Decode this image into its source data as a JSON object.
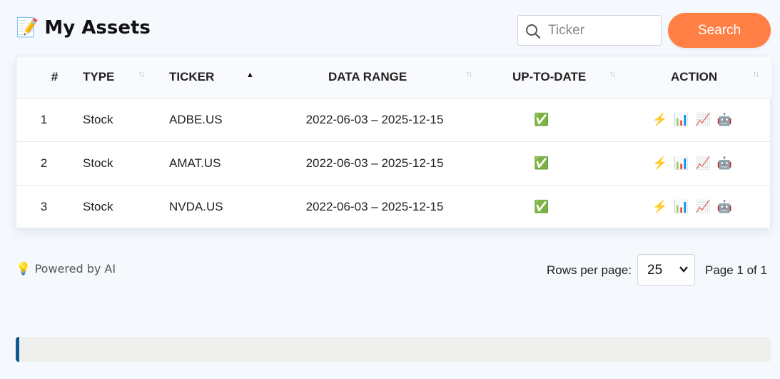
{
  "header": {
    "title_icon": "📝",
    "title": "My Assets",
    "search_placeholder": "Ticker",
    "search_button": "Search"
  },
  "table": {
    "columns": [
      "#",
      "TYPE",
      "TICKER",
      "DATA RANGE",
      "UP-TO-DATE",
      "ACTION"
    ],
    "sorted_column": "TICKER",
    "sort_direction": "ascending",
    "rows": [
      {
        "num": "1",
        "type": "Stock",
        "ticker": "ADBE.US",
        "range": "2022-06-03 – 2025-12-15",
        "up_to_date": "✅"
      },
      {
        "num": "2",
        "type": "Stock",
        "ticker": "AMAT.US",
        "range": "2022-06-03 – 2025-12-15",
        "up_to_date": "✅"
      },
      {
        "num": "3",
        "type": "Stock",
        "ticker": "NVDA.US",
        "range": "2022-06-03 – 2025-12-15",
        "up_to_date": "✅"
      }
    ],
    "action_icons": [
      "lightning-icon",
      "bar-chart-icon",
      "line-chart-icon",
      "robot-icon"
    ]
  },
  "footer": {
    "powered_icon": "💡",
    "powered_text": "Powered by AI",
    "rows_per_page_label": "Rows per page:",
    "rows_per_page_value": "25",
    "page_info": "Page 1 of 1"
  },
  "colors": {
    "accent": "#ff7f45",
    "background": "#f5f8fd",
    "progress_edge": "#0f5a8f",
    "check": "#5fb538"
  }
}
